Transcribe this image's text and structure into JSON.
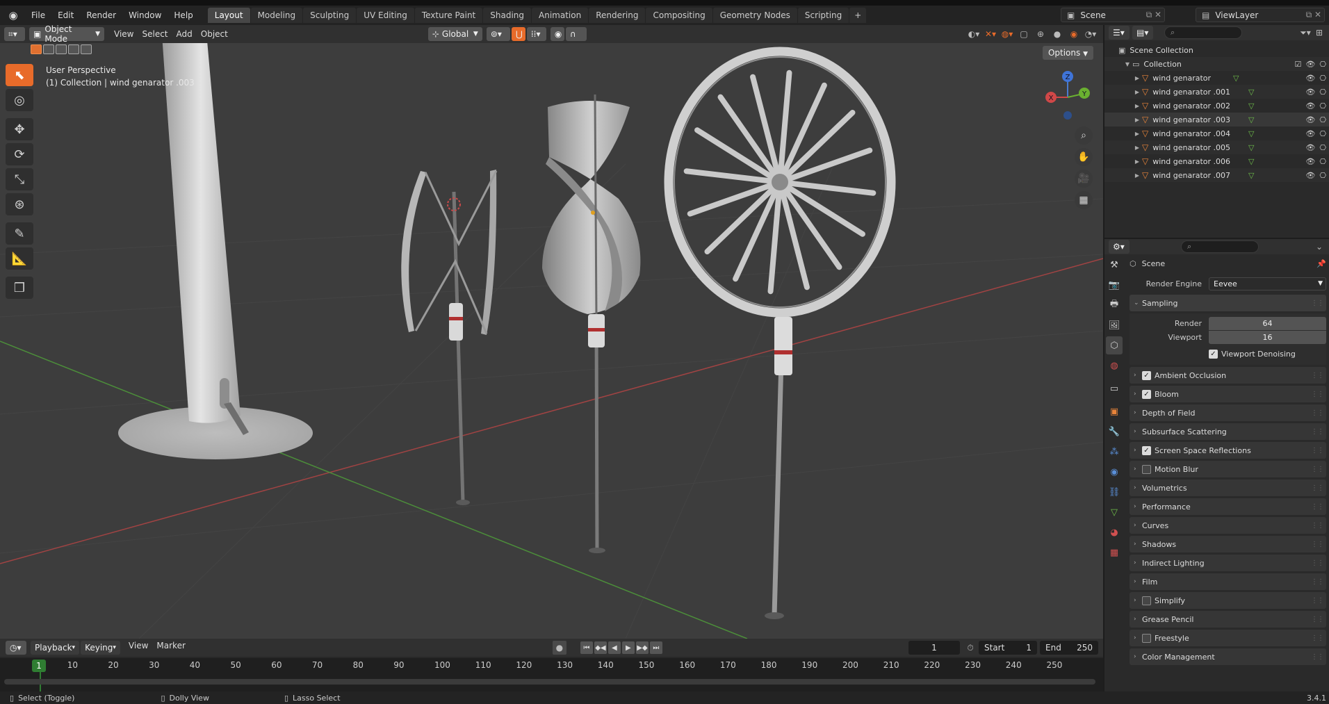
{
  "topbar": {
    "menus": [
      "File",
      "Edit",
      "Render",
      "Window",
      "Help"
    ],
    "workspace_tabs": [
      "Layout",
      "Modeling",
      "Sculpting",
      "UV Editing",
      "Texture Paint",
      "Shading",
      "Animation",
      "Rendering",
      "Compositing",
      "Geometry Nodes",
      "Scripting"
    ],
    "active_tab": "Layout",
    "add_tab_label": "+",
    "scene_name": "Scene",
    "view_layer": "ViewLayer"
  },
  "viewport": {
    "mode": "Object Mode",
    "menus": [
      "View",
      "Select",
      "Add",
      "Object"
    ],
    "transform_orientation": "Global",
    "options_label": "Options",
    "info_line1": "User Perspective",
    "info_line2": "(1) Collection | wind genarator .003",
    "gizmo_axes": {
      "x": "X",
      "y": "Y",
      "z": "Z"
    }
  },
  "outliner": {
    "scene_collection": "Scene Collection",
    "collection": "Collection",
    "items": [
      "wind genarator",
      "wind genarator .001",
      "wind genarator .002",
      "wind genarator .003",
      "wind genarator .004",
      "wind genarator .005",
      "wind genarator .006",
      "wind genarator .007"
    ],
    "selected_index": 3
  },
  "properties": {
    "context": "Scene",
    "render_engine_label": "Render Engine",
    "render_engine": "Eevee",
    "sampling_label": "Sampling",
    "render_label": "Render",
    "render_samples": "64",
    "viewport_label": "Viewport",
    "viewport_samples": "16",
    "viewport_denoising": "Viewport Denoising",
    "sections": [
      {
        "label": "Ambient Occlusion",
        "checkbox": true,
        "checked": true
      },
      {
        "label": "Bloom",
        "checkbox": true,
        "checked": true
      },
      {
        "label": "Depth of Field",
        "checkbox": false,
        "checked": false
      },
      {
        "label": "Subsurface Scattering",
        "checkbox": false,
        "checked": false
      },
      {
        "label": "Screen Space Reflections",
        "checkbox": true,
        "checked": true
      },
      {
        "label": "Motion Blur",
        "checkbox": true,
        "checked": false
      },
      {
        "label": "Volumetrics",
        "checkbox": false,
        "checked": false
      },
      {
        "label": "Performance",
        "checkbox": false,
        "checked": false
      },
      {
        "label": "Curves",
        "checkbox": false,
        "checked": false
      },
      {
        "label": "Shadows",
        "checkbox": false,
        "checked": false
      },
      {
        "label": "Indirect Lighting",
        "checkbox": false,
        "checked": false
      },
      {
        "label": "Film",
        "checkbox": false,
        "checked": false
      },
      {
        "label": "Simplify",
        "checkbox": true,
        "checked": false
      },
      {
        "label": "Grease Pencil",
        "checkbox": false,
        "checked": false
      },
      {
        "label": "Freestyle",
        "checkbox": true,
        "checked": false
      },
      {
        "label": "Color Management",
        "checkbox": false,
        "checked": false
      }
    ]
  },
  "timeline": {
    "menus": [
      "Playback",
      "Keying",
      "View",
      "Marker"
    ],
    "current_frame": "1",
    "start_label": "Start",
    "start": "1",
    "end_label": "End",
    "end": "250",
    "ruler": [
      "10",
      "20",
      "30",
      "40",
      "50",
      "60",
      "70",
      "80",
      "90",
      "100",
      "110",
      "120",
      "130",
      "140",
      "150",
      "160",
      "170",
      "180",
      "190",
      "200",
      "210",
      "220",
      "230",
      "240",
      "250"
    ]
  },
  "status": {
    "select": "Select (Toggle)",
    "dolly": "Dolly View",
    "lasso": "Lasso Select",
    "version": "3.4.1"
  },
  "colors": {
    "accent": "#e86b2a",
    "selection": "#f09050",
    "frame": "#2f7d32"
  }
}
